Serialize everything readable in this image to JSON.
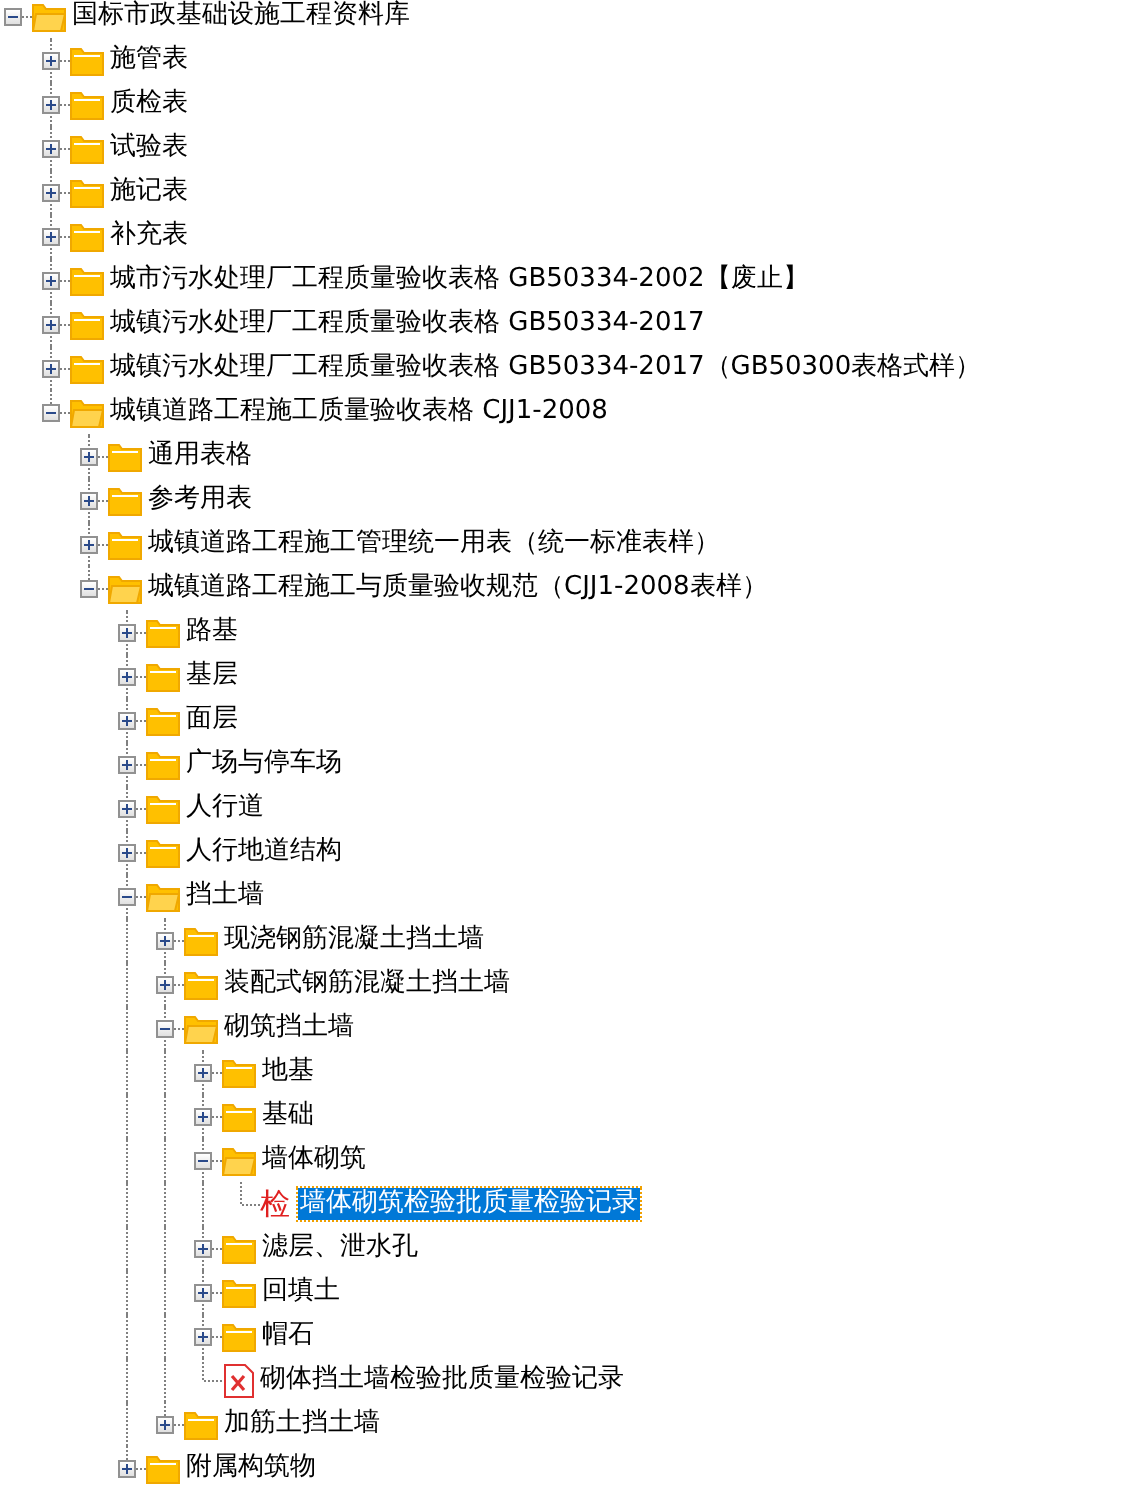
{
  "tree": [
    {
      "kind": "folder",
      "label": "国标市政基础设施工程资料库",
      "expanded": true,
      "selected": false,
      "children": [
        {
          "kind": "folder",
          "label": "施管表",
          "expanded": false,
          "selected": false
        },
        {
          "kind": "folder",
          "label": "质检表",
          "expanded": false,
          "selected": false
        },
        {
          "kind": "folder",
          "label": "试验表",
          "expanded": false,
          "selected": false
        },
        {
          "kind": "folder",
          "label": "施记表",
          "expanded": false,
          "selected": false
        },
        {
          "kind": "folder",
          "label": "补充表",
          "expanded": false,
          "selected": false
        },
        {
          "kind": "folder",
          "label": "城市污水处理厂工程质量验收表格 GB50334-2002【废止】",
          "expanded": false,
          "selected": false
        },
        {
          "kind": "folder",
          "label": "城镇污水处理厂工程质量验收表格 GB50334-2017",
          "expanded": false,
          "selected": false
        },
        {
          "kind": "folder",
          "label": "城镇污水处理厂工程质量验收表格 GB50334-2017（GB50300表格式样）",
          "expanded": false,
          "selected": false
        },
        {
          "kind": "folder",
          "label": "城镇道路工程施工质量验收表格 CJJ1-2008",
          "expanded": true,
          "selected": false,
          "children": [
            {
              "kind": "folder",
              "label": "通用表格",
              "expanded": false,
              "selected": false
            },
            {
              "kind": "folder",
              "label": "参考用表",
              "expanded": false,
              "selected": false
            },
            {
              "kind": "folder",
              "label": "城镇道路工程施工管理统一用表（统一标准表样）",
              "expanded": false,
              "selected": false
            },
            {
              "kind": "folder",
              "label": "城镇道路工程施工与质量验收规范（CJJ1-2008表样）",
              "expanded": true,
              "selected": false,
              "children": [
                {
                  "kind": "folder",
                  "label": "路基",
                  "expanded": false,
                  "selected": false
                },
                {
                  "kind": "folder",
                  "label": "基层",
                  "expanded": false,
                  "selected": false
                },
                {
                  "kind": "folder",
                  "label": "面层",
                  "expanded": false,
                  "selected": false
                },
                {
                  "kind": "folder",
                  "label": "广场与停车场",
                  "expanded": false,
                  "selected": false
                },
                {
                  "kind": "folder",
                  "label": "人行道",
                  "expanded": false,
                  "selected": false
                },
                {
                  "kind": "folder",
                  "label": "人行地道结构",
                  "expanded": false,
                  "selected": false
                },
                {
                  "kind": "folder",
                  "label": "挡土墙",
                  "expanded": true,
                  "selected": false,
                  "children": [
                    {
                      "kind": "folder",
                      "label": "现浇钢筋混凝土挡土墙",
                      "expanded": false,
                      "selected": false
                    },
                    {
                      "kind": "folder",
                      "label": "装配式钢筋混凝土挡土墙",
                      "expanded": false,
                      "selected": false
                    },
                    {
                      "kind": "folder",
                      "label": "砌筑挡土墙",
                      "expanded": true,
                      "selected": false,
                      "children": [
                        {
                          "kind": "folder",
                          "label": "地基",
                          "expanded": false,
                          "selected": false
                        },
                        {
                          "kind": "folder",
                          "label": "基础",
                          "expanded": false,
                          "selected": false
                        },
                        {
                          "kind": "folder",
                          "label": "墙体砌筑",
                          "expanded": true,
                          "selected": false,
                          "children": [
                            {
                              "kind": "mark",
                              "icon_text": "检",
                              "label": "墙体砌筑检验批质量检验记录",
                              "selected": true
                            }
                          ]
                        },
                        {
                          "kind": "folder",
                          "label": "滤层、泄水孔",
                          "expanded": false,
                          "selected": false
                        },
                        {
                          "kind": "folder",
                          "label": "回填土",
                          "expanded": false,
                          "selected": false
                        },
                        {
                          "kind": "folder",
                          "label": "帽石",
                          "expanded": false,
                          "selected": false
                        },
                        {
                          "kind": "document",
                          "label": "砌体挡土墙检验批质量检验记录",
                          "selected": false
                        }
                      ]
                    },
                    {
                      "kind": "folder",
                      "label": "加筋土挡土墙",
                      "expanded": false,
                      "selected": false
                    }
                  ]
                },
                {
                  "kind": "folder",
                  "label": "附属构筑物",
                  "expanded": false,
                  "selected": false
                }
              ]
            }
          ]
        }
      ]
    }
  ]
}
